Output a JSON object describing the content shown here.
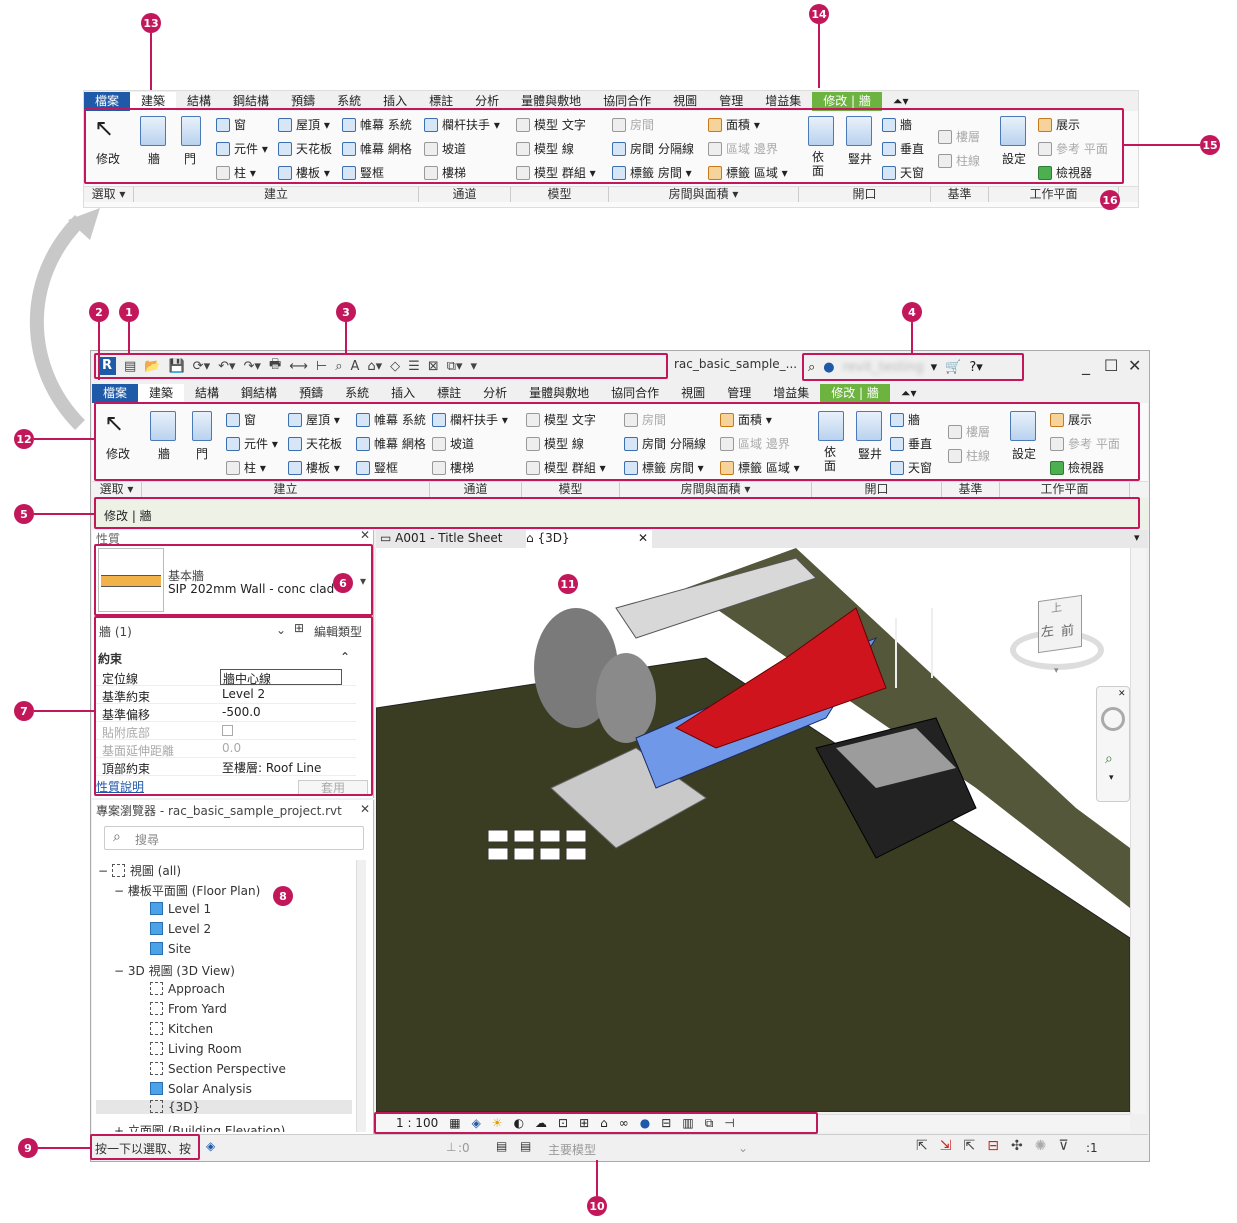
{
  "app": {
    "logo_letter": "R",
    "window_title": "rac_basic_sample_...",
    "user_name": "revit_testing",
    "window_controls": {
      "minimize": "_",
      "maximize": "☐",
      "close": "✕"
    }
  },
  "callouts": {
    "c1": "1",
    "c2": "2",
    "c3": "3",
    "c4": "4",
    "c5": "5",
    "c6": "6",
    "c7": "7",
    "c8": "8",
    "c9": "9",
    "c10": "10",
    "c11": "11",
    "c12": "12",
    "c13": "13",
    "c14": "14",
    "c15": "15",
    "c16": "16"
  },
  "ribbon_tabs": [
    "檔案",
    "建築",
    "結構",
    "鋼結構",
    "預鑄",
    "系統",
    "插入",
    "標註",
    "分析",
    "量體與敷地",
    "協同合作",
    "視圖",
    "管理",
    "增益集",
    "修改 | 牆"
  ],
  "ribbon": {
    "select": {
      "modify": "修改",
      "panel": "選取 ▾"
    },
    "build": {
      "wall": "牆",
      "door": "門",
      "window": "窗",
      "component": "元件 ▾",
      "column": "柱 ▾",
      "roof": "屋頂 ▾",
      "ceiling": "天花板",
      "floor": "樓板 ▾",
      "curtain_system": "帷幕 系統",
      "curtain_grid": "帷幕 網格",
      "mullion": "豎框",
      "panel": "建立"
    },
    "circulation": {
      "railing": "欄杆扶手 ▾",
      "ramp": "坡道",
      "stair": "樓梯",
      "panel": "通道"
    },
    "model": {
      "model_text": "模型 文字",
      "model_line": "模型 線",
      "model_group": "模型 群組 ▾",
      "panel": "模型"
    },
    "room": {
      "room": "房間",
      "room_separator": "分隔線",
      "tag_room": "標籤 房間 ▾",
      "area": "面積 ▾",
      "area_boundary": "區域 邊界",
      "tag_area": "標籤 區域 ▾",
      "panel": "房間與面積 ▾"
    },
    "opening": {
      "by_face": "依 面",
      "shaft": "豎井",
      "wall": "牆",
      "vertical": "垂直",
      "dormer": "天窗",
      "panel": "開口"
    },
    "datum": {
      "level": "樓層",
      "grid": "柱線",
      "panel": "基準"
    },
    "workplane": {
      "set": "設定",
      "show": "展示",
      "ref_plane": "參考 平面",
      "viewer": "檢視器",
      "panel": "工作平面"
    }
  },
  "options_bar": {
    "text": "修改 | 牆"
  },
  "properties": {
    "title": "性質",
    "type_family": "基本牆",
    "type_name": "SIP 202mm Wall - conc clad",
    "instance_filter": "牆 (1)",
    "edit_type": "編輯類型",
    "group": "約束",
    "rows": [
      {
        "name": "定位線",
        "value": "牆中心線",
        "disabled": false
      },
      {
        "name": "基準約束",
        "value": "Level 2",
        "disabled": false
      },
      {
        "name": "基準偏移",
        "value": "-500.0",
        "disabled": false
      },
      {
        "name": "貼附底部",
        "value": "",
        "disabled": true
      },
      {
        "name": "基面延伸距離",
        "value": "0.0",
        "disabled": true
      },
      {
        "name": "頂部約束",
        "value": "至樓層: Roof Line",
        "disabled": false
      }
    ],
    "help_link": "性質說明",
    "apply": "套用"
  },
  "browser": {
    "title": "專案瀏覽器 - rac_basic_sample_project.rvt",
    "search_placeholder": "搜尋",
    "nodes": {
      "views_all": "視圖 (all)",
      "floor_plan": "樓板平面圖 (Floor Plan)",
      "level1": "Level 1",
      "level2": "Level 2",
      "site": "Site",
      "view3d": "3D 視圖 (3D View)",
      "approach": "Approach",
      "from_yard": "From Yard",
      "kitchen": "Kitchen",
      "living_room": "Living Room",
      "section_perspective": "Section Perspective",
      "solar_analysis": "Solar Analysis",
      "d3d": "{3D}",
      "elevation": "立面圖 (Building Elevation)"
    }
  },
  "view_tabs": {
    "sheet": "A001 - Title Sheet",
    "active": "{3D}"
  },
  "viewcube": {
    "top": "上",
    "left": "左",
    "front": "前"
  },
  "view_control_bar": {
    "scale": "1 : 100"
  },
  "status_bar": {
    "prompt": "按一下以選取、按",
    "selection_count": ":0",
    "main_model": "主要模型",
    "filter_count": ":1"
  },
  "colors": {
    "callout": "#c2185b",
    "file_tab": "#1e5aa8",
    "modify_tab": "#6db33f",
    "roof": "#d0141d",
    "terrain": "#3a3d22",
    "glass": "#6f98e8"
  }
}
